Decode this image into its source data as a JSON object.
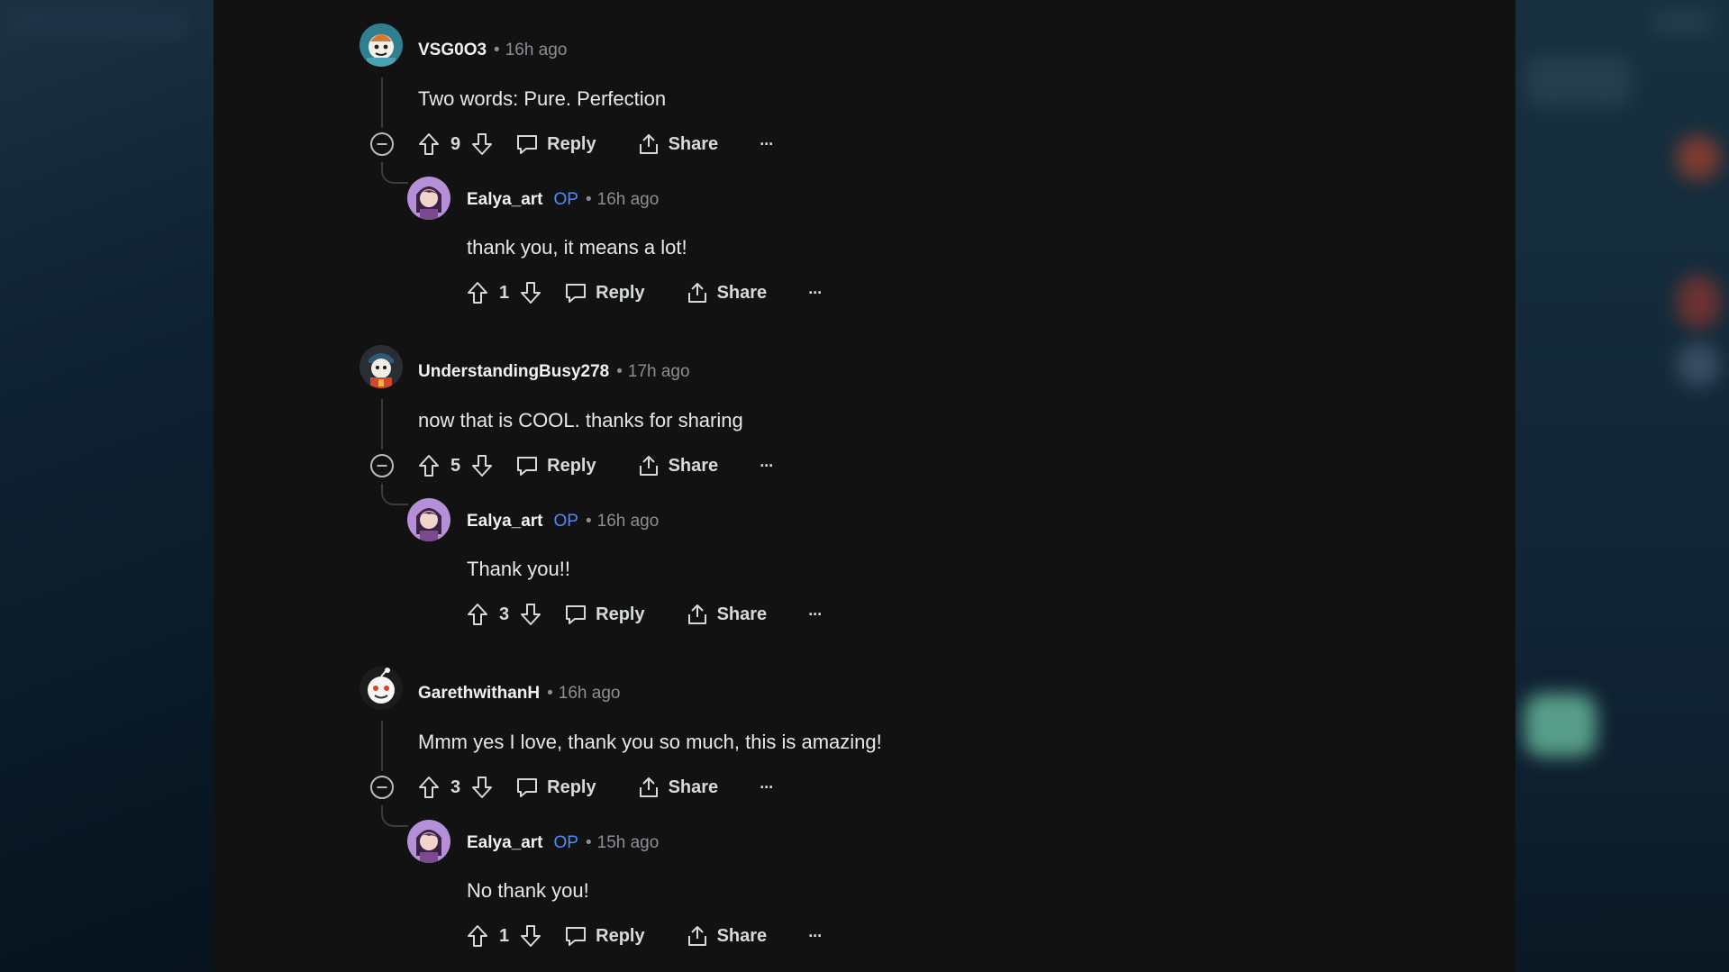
{
  "colors": {
    "panel": "#121212",
    "op_badge": "#4a8cff",
    "meta_text": "#8a8f94",
    "body_text": "#e8e8e8"
  },
  "actions": {
    "reply": "Reply",
    "share": "Share",
    "more": "···"
  },
  "separator": "•",
  "comments": [
    {
      "username": "VSG0O3",
      "time": "16h ago",
      "text": "Two words: Pure. Perfection",
      "votes": "9",
      "reply": {
        "username": "Ealya_art",
        "op": "OP",
        "time": "16h ago",
        "text": "thank you, it means a lot!",
        "votes": "1"
      }
    },
    {
      "username": "UnderstandingBusy278",
      "time": "17h ago",
      "text": "now that is COOL. thanks for sharing",
      "votes": "5",
      "reply": {
        "username": "Ealya_art",
        "op": "OP",
        "time": "16h ago",
        "text": "Thank you!!",
        "votes": "3"
      }
    },
    {
      "username": "GarethwithanH",
      "time": "16h ago",
      "text": "Mmm yes I love, thank you so much, this is amazing!",
      "votes": "3",
      "reply": {
        "username": "Ealya_art",
        "op": "OP",
        "time": "15h ago",
        "text": "No thank you!",
        "votes": "1"
      }
    }
  ]
}
